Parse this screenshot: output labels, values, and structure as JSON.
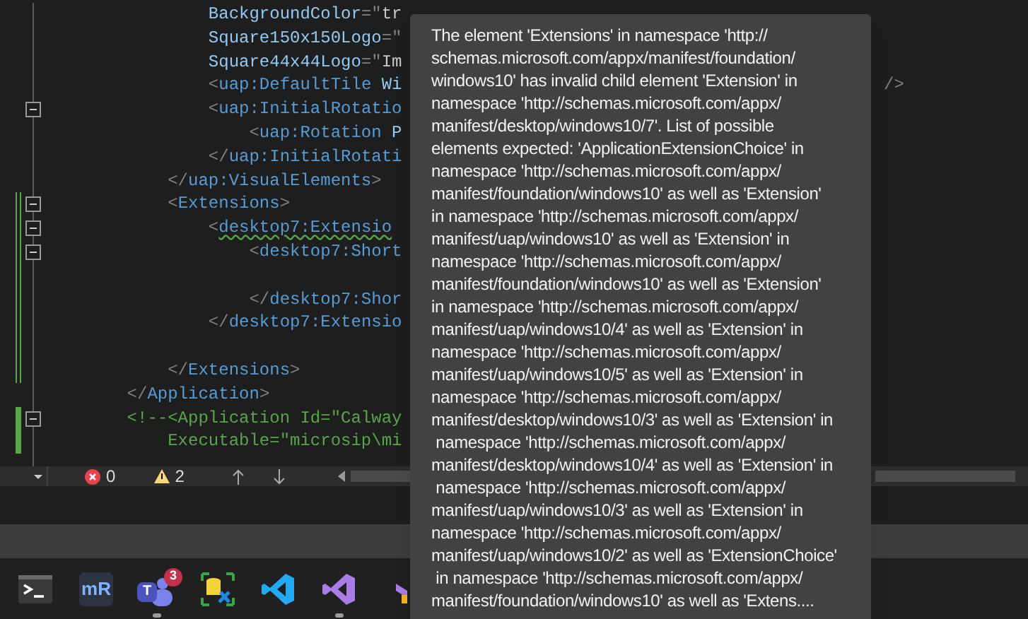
{
  "editor": {
    "lines": [
      {
        "tokens": [
          {
            "t": "            BackgroundColor",
            "kind": "attr"
          },
          {
            "t": "=\"",
            "kind": "punct"
          },
          {
            "t": "tr",
            "kind": "value"
          }
        ]
      },
      {
        "tokens": [
          {
            "t": "            Square150x150Logo",
            "kind": "attr"
          },
          {
            "t": "=\"",
            "kind": "punct"
          }
        ]
      },
      {
        "tokens": [
          {
            "t": "            Square44x44Logo",
            "kind": "attr"
          },
          {
            "t": "=\"",
            "kind": "punct"
          },
          {
            "t": "Im",
            "kind": "value"
          }
        ]
      },
      {
        "tokens": [
          {
            "t": "            <",
            "kind": "punct"
          },
          {
            "t": "uap:DefaultTile",
            "kind": "tag"
          },
          {
            "t": " Wi",
            "kind": "attr"
          }
        ],
        "tail": "/>"
      },
      {
        "tokens": [
          {
            "t": "            <",
            "kind": "punct"
          },
          {
            "t": "uap:InitialRotatio",
            "kind": "tag"
          }
        ],
        "expanded": true
      },
      {
        "tokens": [
          {
            "t": "                <",
            "kind": "punct"
          },
          {
            "t": "uap:Rotation",
            "kind": "tag"
          },
          {
            "t": " P",
            "kind": "attr"
          }
        ]
      },
      {
        "tokens": [
          {
            "t": "            </",
            "kind": "punct"
          },
          {
            "t": "uap:InitialRotati",
            "kind": "tag"
          }
        ]
      },
      {
        "tokens": [
          {
            "t": "        </",
            "kind": "punct"
          },
          {
            "t": "uap:VisualElements",
            "kind": "tag"
          },
          {
            "t": ">",
            "kind": "punct"
          }
        ]
      },
      {
        "tokens": [
          {
            "t": "        <",
            "kind": "punct"
          },
          {
            "t": "Extensions",
            "kind": "tag"
          },
          {
            "t": ">",
            "kind": "punct"
          }
        ],
        "expanded": true,
        "saved": true
      },
      {
        "tokens": [
          {
            "t": "            <",
            "kind": "punct"
          },
          {
            "t": "desktop7:Extensio",
            "kind": "tag",
            "squiggle": true
          }
        ],
        "expanded": true,
        "saved": true
      },
      {
        "tokens": [
          {
            "t": "                <",
            "kind": "punct"
          },
          {
            "t": "desktop7:Short",
            "kind": "tag"
          }
        ],
        "expanded": true,
        "saved": true
      },
      {
        "saved": true
      },
      {
        "tokens": [
          {
            "t": "                </",
            "kind": "punct"
          },
          {
            "t": "desktop7:Shor",
            "kind": "tag"
          }
        ],
        "saved": true
      },
      {
        "tokens": [
          {
            "t": "            </",
            "kind": "punct"
          },
          {
            "t": "desktop7:Extensio",
            "kind": "tag"
          }
        ],
        "saved": true
      },
      {
        "saved": true
      },
      {
        "tokens": [
          {
            "t": "        </",
            "kind": "punct"
          },
          {
            "t": "Extensions",
            "kind": "tag"
          },
          {
            "t": ">",
            "kind": "punct"
          }
        ],
        "saved": true
      },
      {
        "tokens": [
          {
            "t": "    </",
            "kind": "punct"
          },
          {
            "t": "Application",
            "kind": "tag"
          },
          {
            "t": ">",
            "kind": "punct"
          }
        ]
      },
      {
        "tokens": [
          {
            "t": "    <!--<Application Id=\"Calway",
            "kind": "comment"
          }
        ],
        "expanded": true,
        "saved": false
      },
      {
        "tokens": [
          {
            "t": "        Executable=\"microsip\\mi",
            "kind": "comment"
          }
        ],
        "saved": false
      }
    ]
  },
  "status": {
    "errors": "0",
    "warnings": "2"
  },
  "tooltip": {
    "lines": [
      "The element 'Extensions' in namespace 'http://",
      "schemas.microsoft.com/appx/manifest/foundation/",
      "windows10' has invalid child element 'Extension' in",
      "namespace 'http://schemas.microsoft.com/appx/",
      "manifest/desktop/windows10/7'. List of possible",
      "elements expected: 'ApplicationExtensionChoice' in",
      "namespace 'http://schemas.microsoft.com/appx/",
      "manifest/foundation/windows10' as well as 'Extension'",
      "in namespace 'http://schemas.microsoft.com/appx/",
      "manifest/uap/windows10' as well as 'Extension' in",
      "namespace 'http://schemas.microsoft.com/appx/",
      "manifest/foundation/windows10' as well as 'Extension'",
      "in namespace 'http://schemas.microsoft.com/appx/",
      "manifest/uap/windows10/4' as well as 'Extension' in",
      "namespace 'http://schemas.microsoft.com/appx/",
      "manifest/uap/windows10/5' as well as 'Extension' in",
      "namespace 'http://schemas.microsoft.com/appx/",
      "manifest/desktop/windows10/3' as well as 'Extension' in",
      " namespace 'http://schemas.microsoft.com/appx/",
      "manifest/desktop/windows10/4' as well as 'Extension' in",
      " namespace 'http://schemas.microsoft.com/appx/",
      "manifest/uap/windows10/3' as well as 'Extension' in",
      "namespace 'http://schemas.microsoft.com/appx/",
      "manifest/uap/windows10/2' as well as 'ExtensionChoice'",
      " in namespace 'http://schemas.microsoft.com/appx/",
      "manifest/foundation/windows10' as well as 'Extens...."
    ]
  },
  "taskbar": {
    "apps": [
      {
        "kind": "terminal",
        "running": false
      },
      {
        "kind": "mr",
        "label": "mR",
        "running": false
      },
      {
        "kind": "teams",
        "label": "T",
        "badge": "3",
        "running": true
      },
      {
        "kind": "dbtool",
        "running": false
      },
      {
        "kind": "vscode",
        "running": false
      },
      {
        "kind": "vs",
        "running": true
      },
      {
        "kind": "vspreview",
        "running": false
      }
    ]
  }
}
